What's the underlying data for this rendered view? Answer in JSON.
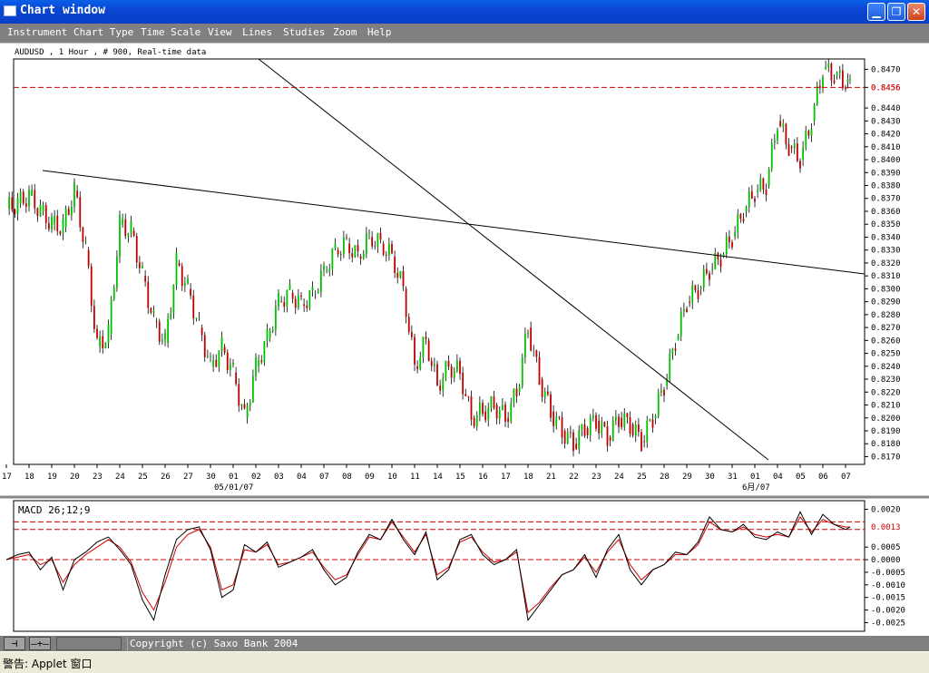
{
  "window": {
    "title": "Chart window"
  },
  "menu": [
    "Instrument",
    "Chart Type",
    "Time Scale",
    "View",
    "Lines",
    "Studies",
    "Zoom",
    "Help"
  ],
  "chart": {
    "info": "AUDUSD , 1 Hour , # 900, Real-time data",
    "y_labels": [
      "0.8470",
      "0.8456",
      "0.8440",
      "0.8430",
      "0.8420",
      "0.8410",
      "0.8400",
      "0.8390",
      "0.8380",
      "0.8370",
      "0.8360",
      "0.8350",
      "0.8340",
      "0.8330",
      "0.8320",
      "0.8310",
      "0.8300",
      "0.8290",
      "0.8280",
      "0.8270",
      "0.8260",
      "0.8250",
      "0.8240",
      "0.8230",
      "0.8220",
      "0.8210",
      "0.8200",
      "0.8190",
      "0.8180",
      "0.8170"
    ],
    "current_price": "0.8456",
    "x_labels": [
      "17",
      "18",
      "19",
      "20",
      "23",
      "24",
      "25",
      "26",
      "27",
      "30",
      "01",
      "02",
      "03",
      "04",
      "07",
      "08",
      "09",
      "10",
      "11",
      "14",
      "15",
      "16",
      "17",
      "18",
      "21",
      "22",
      "23",
      "24",
      "25",
      "28",
      "29",
      "30",
      "31",
      "01",
      "04",
      "05",
      "06",
      "07"
    ],
    "month_labels": [
      "05/01/07",
      "6月/07"
    ]
  },
  "chart_data": {
    "type": "line",
    "title": "AUDUSD , 1 Hour , # 900, Real-time data",
    "xlabel": "",
    "ylabel": "",
    "ylim": [
      0.8164,
      0.8478
    ],
    "dates": [
      "17",
      "18",
      "19",
      "20",
      "23",
      "24",
      "25",
      "26",
      "27",
      "30",
      "01",
      "02",
      "03",
      "04",
      "07",
      "08",
      "09",
      "10",
      "11",
      "14",
      "15",
      "16",
      "17",
      "18",
      "21",
      "22",
      "23",
      "24",
      "25",
      "28",
      "29",
      "30",
      "31",
      "01",
      "04",
      "05",
      "06",
      "07"
    ],
    "x": [
      0,
      0.5,
      1,
      1.5,
      2,
      2.5,
      3,
      3.5,
      4,
      4.5,
      5,
      5.5,
      6,
      6.5,
      7,
      7.5,
      8,
      8.5,
      9,
      9.5,
      10,
      10.5,
      11,
      11.5,
      12,
      12.5,
      13,
      13.5,
      14,
      14.5,
      15,
      15.5,
      16,
      16.5,
      17,
      17.5,
      18,
      18.5,
      19,
      19.5,
      20,
      20.5,
      21,
      21.5,
      22,
      22.5,
      23,
      23.5,
      24,
      24.5,
      25,
      25.5,
      26,
      26.5,
      27,
      27.5,
      28,
      28.5,
      29,
      29.5,
      30,
      30.5,
      31,
      31.5,
      32,
      32.5,
      33,
      33.5,
      34,
      34.5,
      35,
      35.5,
      36,
      36.5,
      37,
      37.2
    ],
    "series": [
      {
        "values": [
          0.8362,
          0.8366,
          0.8372,
          0.836,
          0.835,
          0.8348,
          0.8376,
          0.833,
          0.8255,
          0.8265,
          0.835,
          0.8345,
          0.831,
          0.8275,
          0.8258,
          0.832,
          0.83,
          0.827,
          0.824,
          0.8255,
          0.8235,
          0.82,
          0.824,
          0.8262,
          0.829,
          0.8297,
          0.8288,
          0.8296,
          0.8313,
          0.833,
          0.8335,
          0.8325,
          0.834,
          0.8335,
          0.8325,
          0.83,
          0.824,
          0.826,
          0.8225,
          0.824,
          0.8235,
          0.82,
          0.8205,
          0.821,
          0.82,
          0.822,
          0.827,
          0.823,
          0.8205,
          0.819,
          0.818,
          0.8192,
          0.8198,
          0.8185,
          0.82,
          0.8195,
          0.8182,
          0.82,
          0.8225,
          0.826,
          0.829,
          0.83,
          0.8315,
          0.8325,
          0.834,
          0.836,
          0.8375,
          0.838,
          0.843,
          0.841,
          0.84,
          0.843,
          0.847,
          0.8465,
          0.846,
          0.8456
        ]
      }
    ],
    "reference_lines": [
      {
        "y": 0.8456,
        "label": "0.8456"
      }
    ],
    "macd": {
      "title": "MACD 26;12;9",
      "ylim": [
        -0.0027,
        0.0022
      ],
      "y_labels": [
        "0.0020",
        "0.0013",
        "0.0005",
        "0.0000",
        "-0.0005",
        "-0.0010",
        "-0.0015",
        "-0.0020",
        "-0.0025"
      ],
      "current_value": "0.0013",
      "reference_lines": [
        0.0015,
        0.0012,
        0.0
      ],
      "macd_line": [
        0.0,
        0.0002,
        0.0003,
        -0.0004,
        0.0001,
        -0.0012,
        0.0,
        0.0003,
        0.0007,
        0.0009,
        0.0004,
        -0.0002,
        -0.0016,
        -0.0024,
        -0.0006,
        0.0008,
        0.0012,
        0.0013,
        0.0004,
        -0.0015,
        -0.0012,
        0.0006,
        0.0003,
        0.0007,
        -0.0003,
        -0.0001,
        0.0001,
        0.0004,
        -0.0004,
        -0.001,
        -0.0007,
        0.0003,
        0.001,
        0.0008,
        0.0016,
        0.0008,
        0.0002,
        0.0011,
        -0.0008,
        -0.0004,
        0.0008,
        0.001,
        0.0002,
        -0.0002,
        0.0,
        0.0004,
        -0.0024,
        -0.0018,
        -0.0012,
        -0.0006,
        -0.0004,
        0.0002,
        -0.0007,
        0.0004,
        0.001,
        -0.0004,
        -0.001,
        -0.0004,
        -0.0002,
        0.0003,
        0.0002,
        0.0007,
        0.0017,
        0.0012,
        0.0011,
        0.0014,
        0.0009,
        0.0008,
        0.0011,
        0.0009,
        0.0019,
        0.001,
        0.0018,
        0.0014,
        0.0012,
        0.0013
      ],
      "signal_line": [
        0.0,
        0.0001,
        0.0002,
        -0.0002,
        0.0,
        -0.0009,
        -0.0002,
        0.0002,
        0.0005,
        0.0008,
        0.0005,
        -0.0001,
        -0.0013,
        -0.002,
        -0.0009,
        0.0005,
        0.001,
        0.0012,
        0.0005,
        -0.0012,
        -0.001,
        0.0004,
        0.0003,
        0.0006,
        -0.0002,
        -0.0001,
        0.0001,
        0.0003,
        -0.0003,
        -0.0008,
        -0.0006,
        0.0002,
        0.0009,
        0.0008,
        0.0015,
        0.0009,
        0.0003,
        0.001,
        -0.0006,
        -0.0003,
        0.0007,
        0.0009,
        0.0003,
        -0.0001,
        0.0,
        0.0003,
        -0.0021,
        -0.0017,
        -0.0011,
        -0.0006,
        -0.0004,
        0.0001,
        -0.0005,
        0.0003,
        0.0008,
        -0.0002,
        -0.0008,
        -0.0004,
        -0.0002,
        0.0002,
        0.0002,
        0.0006,
        0.0015,
        0.0012,
        0.0011,
        0.0013,
        0.001,
        0.0009,
        0.001,
        0.0009,
        0.0017,
        0.0011,
        0.0016,
        0.0014,
        0.0013,
        0.0013
      ]
    }
  },
  "bottom": {
    "copyright": "Copyright (c) Saxo Bank 2004",
    "tool_1": "⊣",
    "tool_2": "—+—"
  },
  "status": {
    "text": "警告: Applet 窗口"
  },
  "colors": {
    "up": "#00c000",
    "down": "#c00000",
    "dash": "#cc0000",
    "signal": "#cc0000"
  }
}
